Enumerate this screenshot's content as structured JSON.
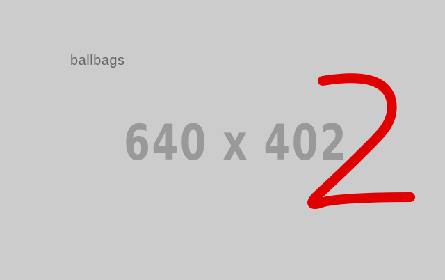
{
  "placeholder": {
    "label": "ballbags",
    "dimensions": "640 x 402",
    "annotation_digit": "2",
    "colors": {
      "background": "#cccccc",
      "label": "#666666",
      "dimensions": "#999999",
      "annotation": "#e00000"
    }
  }
}
